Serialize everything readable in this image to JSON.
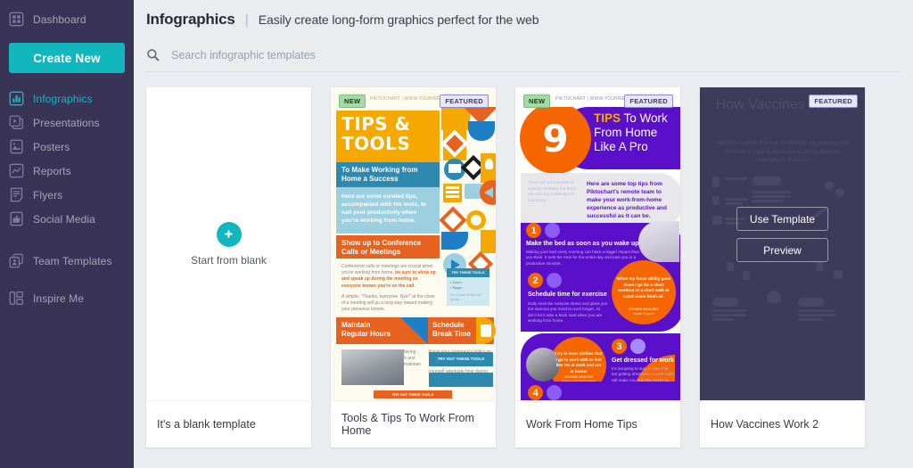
{
  "sidebar": {
    "brand_accent": "#12b6bd",
    "bg": "#393456",
    "dashboard": {
      "label": "Dashboard",
      "icon": "grid-icon"
    },
    "create_new_label": "Create New",
    "items": [
      {
        "label": "Infographics",
        "icon": "bar-chart-icon",
        "active": true
      },
      {
        "label": "Presentations",
        "icon": "slides-icon",
        "active": false
      },
      {
        "label": "Posters",
        "icon": "image-icon",
        "active": false
      },
      {
        "label": "Reports",
        "icon": "line-chart-icon",
        "active": false
      },
      {
        "label": "Flyers",
        "icon": "document-icon",
        "active": false
      },
      {
        "label": "Social Media",
        "icon": "thumbs-up-icon",
        "active": false
      }
    ],
    "team_templates": {
      "label": "Team Templates",
      "icon": "team-copy-icon"
    },
    "inspire_me": {
      "label": "Inspire Me",
      "icon": "layout-blocks-icon"
    }
  },
  "header": {
    "title": "Infographics",
    "separator": "|",
    "subtitle": "Easily create long-form graphics perfect for the web"
  },
  "search": {
    "icon": "search-icon",
    "placeholder": "Search infographic templates",
    "value": ""
  },
  "cards": [
    {
      "caption": "It's a blank template",
      "type": "blank",
      "blank_label": "Start from blank",
      "plus_icon": "plus-icon",
      "badges": []
    },
    {
      "caption": "Tools & Tips To Work From Home",
      "type": "template",
      "badges": [
        "NEW",
        "FEATURED"
      ],
      "watermark": "PIKTOCHART  |  WWW.YOURWEBSITE.COM",
      "art": {
        "title": "TIPS & TOOLS",
        "subtitle": "To Make Working from Home a Success",
        "body": "Here are some curated tips, accompanied with the tools, to nail your productivity when you're working from home.",
        "cta": "Show up to Conference Calls or Meetings",
        "para1_a": "Conference calls or meetings are crucial when you're working from home, ",
        "para1_b": "be sure to show up and speak up during the meeting so everyone knows you're on the call.",
        "para2": "A simple, \"Thanks, everyone. Bye!\" at the close of a meeting will go a long way toward making your presence known.",
        "tip_header": "TRY THESE TOOLS",
        "tip_items": "• Zoom\n• Skype",
        "tip_note": "For a more stable call quality",
        "section2_title": "Maintain Regular Hours",
        "section3_title": "Schedule Break Time",
        "section2_body": "Set a schedule, and stick to it. Having clear guidelines for when to work and when to call it a day will help to maintain work-life balance.",
        "section3_body": "Know your company's policy on break times and take them. If you're self employed, give yourself adequate time during the day to walk away from the computer screen and phone.",
        "tool_btn": "TRY OUT THESE TOOLS",
        "bottom_btn": "TRY OUT THESE TOOLS"
      }
    },
    {
      "caption": "Work From Home Tips",
      "type": "template",
      "badges": [
        "NEW",
        "FEATURED"
      ],
      "watermark": "PIKTOCHART  |  WWW.YOURWEBSITE.COM",
      "art": {
        "big_number": "9",
        "title_accent": "TIPS",
        "title_rest": " To Work From Home Like A Pro",
        "intro_left": "There are real benefits to working remotely but there are also big challenges to overcome.",
        "intro_right": "Here are some top tips from Piktochart's remote team to make your work-from-home experience as productive and successful as it can be.",
        "tips": [
          {
            "num": "1",
            "head": "Make the bed as soon as you wake up",
            "body": "Making your bed every morning can have a bigger impact than you think. It sets the tone for the entire day and puts you in a productive mindset."
          },
          {
            "num": "2",
            "head": "Schedule time for exercise",
            "body": "Daily exercise reduces stress and gives you the stamina you need to work longer, so don't let it take a back seat when you are working from home."
          },
          {
            "num": "3",
            "head": "Get dressed for work",
            "body": "It's tempting to stay in your PJs, but getting dressed in a work outfit will make you feel like you're at work and not at home so you are more determined to get your work done."
          },
          {
            "num": "4",
            "head": "",
            "body": ""
          }
        ],
        "quote1": "When my focus ability goes down I go for a short workout or a short walk to catch some fresh air.",
        "quote1_author": "OTHNEE BOUCHEZ",
        "quote1_role": "Growth Engineer",
        "quote2": "I try to wear clothes that I go to work with to feel like I'm at work and not at home!",
        "quote2_author": "MAKSIM SIDIAKIN",
        "quote2_role": "Senior Lead Online Brand"
      }
    },
    {
      "caption": "How Vaccines Work 2",
      "type": "template",
      "hovered": true,
      "badges": [
        "FEATURED"
      ],
      "art": {
        "title": "How Vaccines Works",
        "subtitle": "Vaccines reduce the risk of infection by working with the body's natural defences to safely develop immunity to disease."
      },
      "hover": {
        "use_template_label": "Use Template",
        "preview_label": "Preview"
      }
    }
  ]
}
